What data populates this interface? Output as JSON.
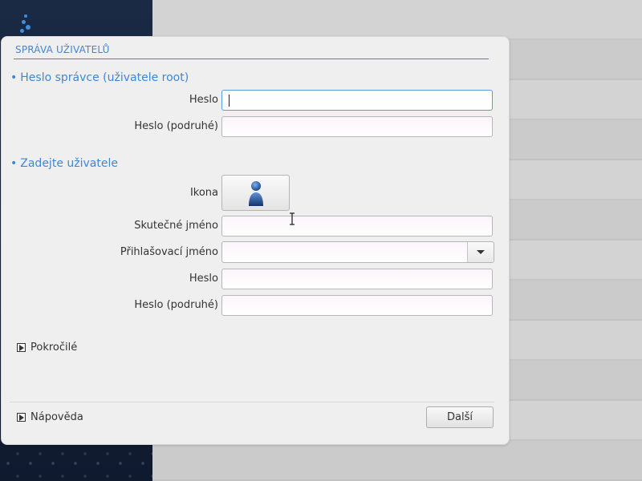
{
  "dialog": {
    "title": "SPRÁVA UŽIVATELŮ"
  },
  "root_section": {
    "bullet": "•",
    "heading": "Heslo správce (uživatele root)",
    "password_label": "Heslo",
    "password_value": "",
    "password_confirm_label": "Heslo (podruhé)",
    "password_confirm_value": ""
  },
  "user_section": {
    "bullet": "•",
    "heading": "Zadejte uživatele",
    "icon_label": "Ikona",
    "icon_name": "user-avatar-icon",
    "real_name_label": "Skutečné jméno",
    "real_name_value": "",
    "login_label": "Přihlašovací jméno",
    "login_value": "",
    "password_label": "Heslo",
    "password_value": "",
    "password_confirm_label": "Heslo (podruhé)",
    "password_confirm_value": ""
  },
  "advanced": {
    "label": "Pokročilé"
  },
  "footer": {
    "help_label": "Nápověda",
    "next_label": "Další"
  },
  "colors": {
    "accent": "#3f87d6",
    "sidebar": "#1b2a44",
    "dialog_bg": "#efefef"
  }
}
